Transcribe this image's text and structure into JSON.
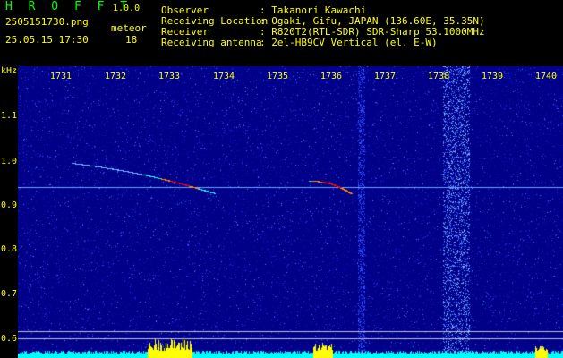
{
  "app": {
    "brand": "H R O F F T",
    "version": "1.0.0"
  },
  "capture": {
    "filename": "2505151730.png",
    "datetime": "25.05.15 17:30",
    "meteor_label": "meteor",
    "meteor_count": "18"
  },
  "info": [
    {
      "label": "Observer",
      "value": ": Takanori Kawachi"
    },
    {
      "label": "Receiving Location",
      "value": ": Ogaki, Gifu, JAPAN (136.60E, 35.35N)"
    },
    {
      "label": "Receiver",
      "value": ": R820T2(RTL-SDR) SDR-Sharp 53.1000MHz"
    },
    {
      "label": "Receiving antenna",
      "value": ": 2el-HB9CV Vertical (el. E-W)"
    }
  ],
  "axis": {
    "unit": "kHz",
    "y_ticks": [
      "1.1",
      "1.0",
      "0.9",
      "0.8",
      "0.7",
      "0.6"
    ],
    "x_ticks": [
      "1731",
      "1732",
      "1733",
      "1734",
      "1735",
      "1736",
      "1737",
      "1738",
      "1739",
      "1740"
    ]
  },
  "colors": {
    "label": "#ffff00",
    "brand": "#00ff00",
    "background": "#000088",
    "meteor": "#ff0000",
    "activity": "#ffff00",
    "baseline": "#00ffff"
  }
}
